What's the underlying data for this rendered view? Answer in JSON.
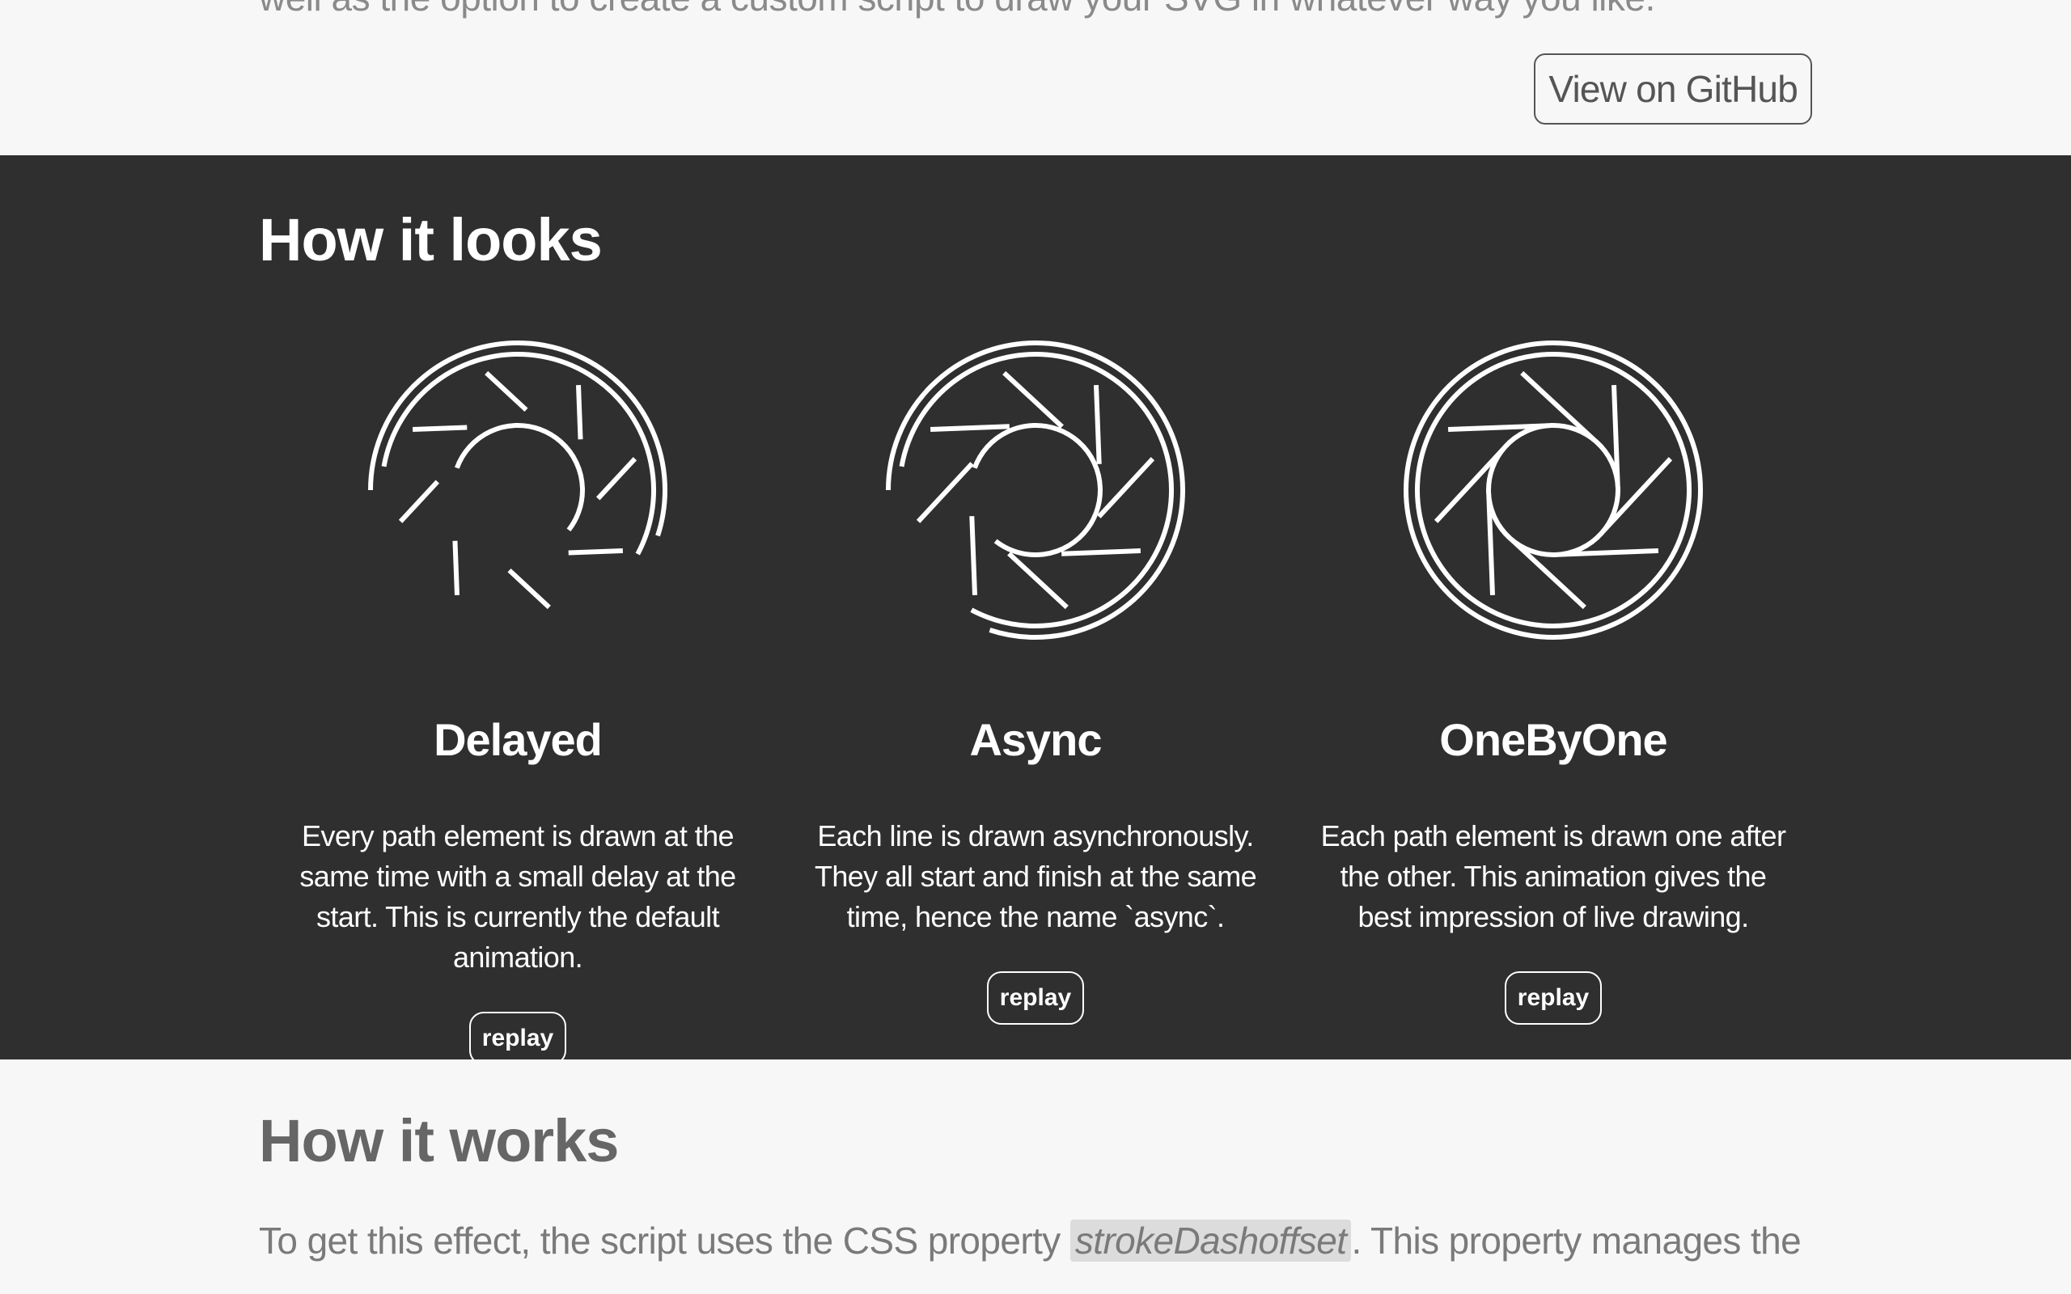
{
  "intro": {
    "tail_text": "well as the option to create a custom script to draw your SVG in whatever way you like."
  },
  "github_button": {
    "label": "View on GitHub"
  },
  "how_it_looks": {
    "heading": "How it looks",
    "demos": [
      {
        "title": "Delayed",
        "description": "Every path element is drawn at the same time with a small delay at the start. This is currently the default animation.",
        "button": "replay",
        "progress": 0.55
      },
      {
        "title": "Async",
        "description": "Each line is drawn asynchronously. They all start and finish at the same time, hence the name `async`.",
        "button": "replay",
        "progress": 0.8
      },
      {
        "title": "OneByOne",
        "description": "Each path element is drawn one after the other. This animation gives the best impression of live drawing.",
        "button": "replay",
        "progress": 1.0
      }
    ]
  },
  "how_it_works": {
    "heading": "How it works",
    "text_before": "To get this effect, the script uses the CSS property ",
    "code": "strokeDashoffset",
    "text_after": ". This property manages the"
  },
  "colors": {
    "dark_bg": "#2f2f2f",
    "light_bg": "#f7f7f7",
    "stroke": "#ffffff"
  },
  "icons": {
    "demo_graphic": "camera-aperture-icon"
  }
}
